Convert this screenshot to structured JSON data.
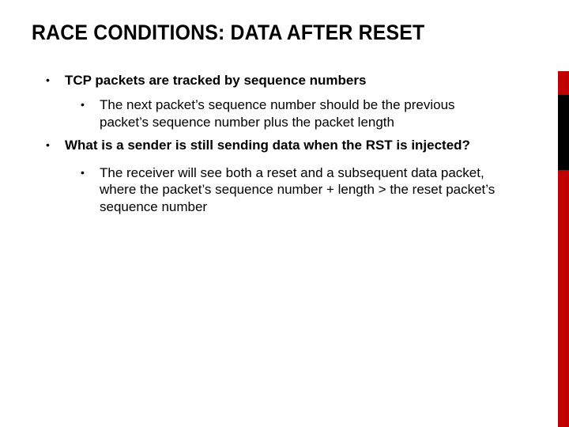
{
  "title": "RACE CONDITIONS: DATA AFTER RESET",
  "bullets": {
    "b1": "TCP packets are tracked by sequence numbers",
    "b1_1": "The next packet’s sequence number should be the previous packet’s sequence number plus the packet length",
    "b2": "What is a sender is still sending data when the RST is injected?",
    "b2_1": "The receiver will see both a reset and a subsequent data packet, where the packet’s sequence number + length > the reset packet’s sequence number"
  },
  "colors": {
    "accent": "#c00000",
    "black": "#000000"
  }
}
